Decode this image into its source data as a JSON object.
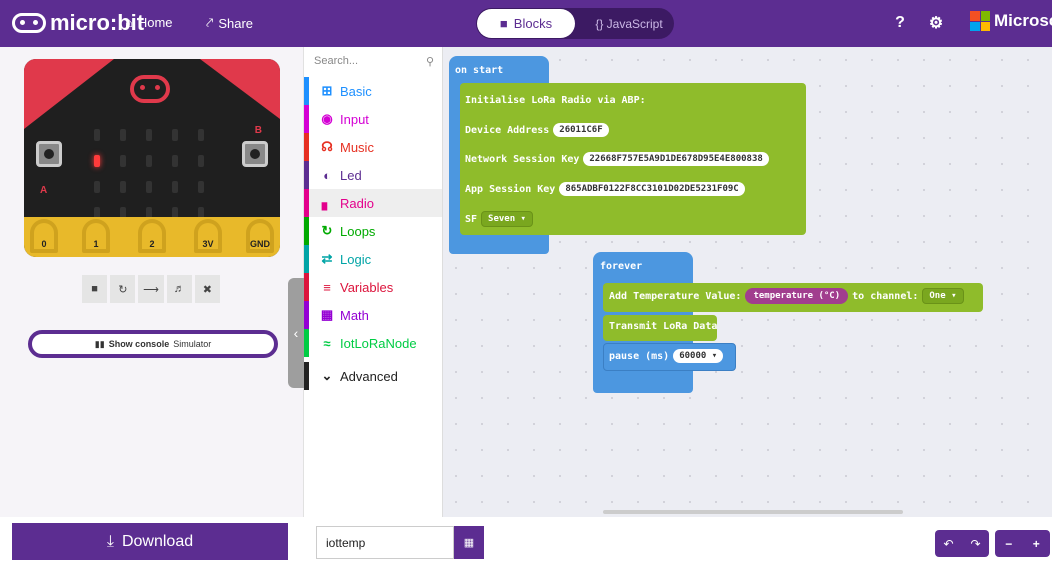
{
  "header": {
    "brand": "micro:bit",
    "home": "Home",
    "share": "Share",
    "blocks": "Blocks",
    "javascript": "{} JavaScript",
    "microsoft": "Microsoft"
  },
  "simulator": {
    "pins": [
      "0",
      "1",
      "2",
      "3V",
      "GND"
    ],
    "button_a": "A",
    "button_b": "B",
    "console_label": "Show console",
    "console_suffix": "Simulator"
  },
  "toolbox": {
    "search_placeholder": "Search...",
    "categories": [
      {
        "label": "Basic",
        "color": "#1e90ff"
      },
      {
        "label": "Input",
        "color": "#d400d4"
      },
      {
        "label": "Music",
        "color": "#e63022"
      },
      {
        "label": "Led",
        "color": "#5c2d91"
      },
      {
        "label": "Radio",
        "color": "#e3008c"
      },
      {
        "label": "Loops",
        "color": "#00aa00"
      },
      {
        "label": "Logic",
        "color": "#00a4a6"
      },
      {
        "label": "Variables",
        "color": "#dc143c"
      },
      {
        "label": "Math",
        "color": "#9400d3"
      },
      {
        "label": "IotLoRaNode",
        "color": "#00cc44"
      }
    ],
    "advanced": "Advanced"
  },
  "workspace": {
    "on_start": "on start",
    "init_lora": "Initialise LoRa Radio via ABP:",
    "device_address_label": "Device Address",
    "device_address": "26011C6F",
    "network_key_label": "Network Session Key",
    "network_key": "22668F757E5A9D1DE678D95E4E800838",
    "app_key_label": "App Session Key",
    "app_key": "865ADBF0122F8CC3101D02DE5231F09C",
    "sf_label": "SF",
    "sf_value": "Seven",
    "forever": "forever",
    "add_temp": "Add Temperature Value:",
    "temperature": "temperature (°C)",
    "to_channel": "to channel:",
    "channel": "One",
    "transmit": "Transmit LoRa Data",
    "pause": "pause (ms)",
    "pause_value": "60000"
  },
  "footer": {
    "download": "Download",
    "project_name": "iottemp"
  }
}
